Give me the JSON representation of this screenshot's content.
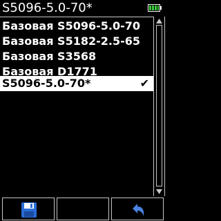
{
  "title_bar": {
    "title": "S5096-5.0-70*",
    "battery_icon": "battery-icon"
  },
  "list": {
    "items": [
      {
        "label": "Базовая S5096-5.0-70",
        "selected": false
      },
      {
        "label": "Базовая S5182-2.5-65",
        "selected": false
      },
      {
        "label": "Базовая S3568",
        "selected": false
      },
      {
        "label": "Базовая D1771",
        "selected": false
      },
      {
        "label": "S5096-5.0-70*",
        "selected": true,
        "check": "✔"
      }
    ]
  },
  "softkeys": {
    "left_icon": "save-icon",
    "middle_icon": "",
    "right_icon": "back-icon"
  },
  "colors": {
    "background": "#000000",
    "foreground": "#ffffff",
    "battery_fill": "#3ec83e",
    "save_icon": "#2b6cd6",
    "back_icon": "#4a82e0"
  }
}
